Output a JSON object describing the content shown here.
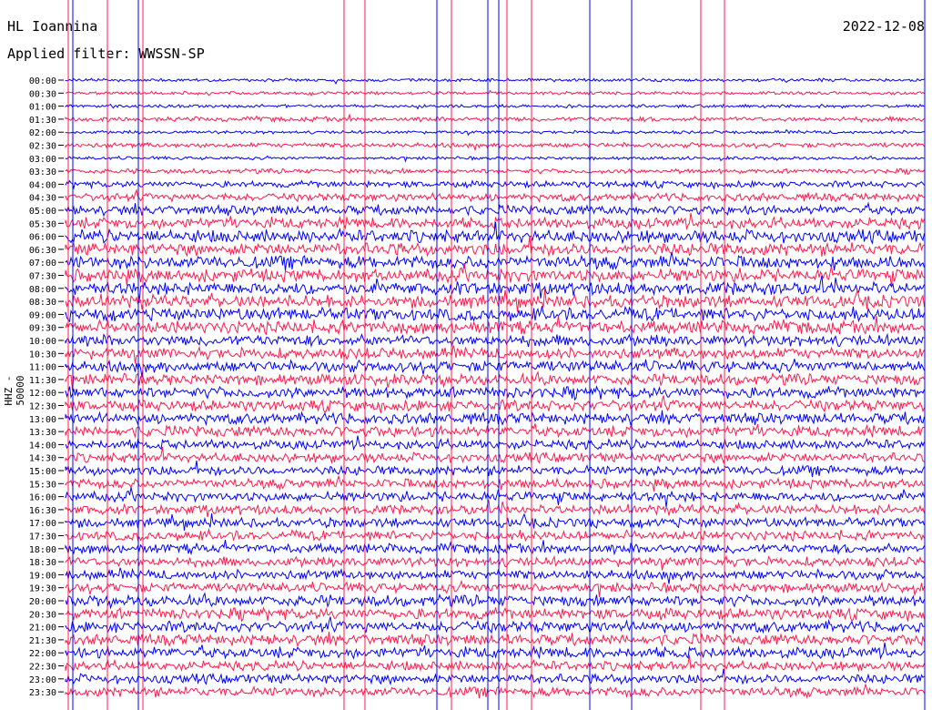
{
  "header": {
    "station": "HL Ioannina",
    "date": "2022-12-08",
    "filter": "Applied filter: WWSSN-SP",
    "channel": "HHZ - 50000"
  },
  "chart_data": {
    "type": "line",
    "title": "HL Ioannina",
    "ylabel": "HHZ - 50000",
    "y_tick_labels": [
      "00:00",
      "00:30",
      "01:00",
      "01:30",
      "02:00",
      "02:30",
      "03:00",
      "03:30",
      "04:00",
      "04:30",
      "05:00",
      "05:30",
      "06:00",
      "06:30",
      "07:00",
      "07:30",
      "08:00",
      "08:30",
      "09:00",
      "09:30",
      "10:00",
      "10:30",
      "11:00",
      "11:30",
      "12:00",
      "12:30",
      "13:00",
      "13:30",
      "14:00",
      "14:30",
      "15:00",
      "15:30",
      "16:00",
      "16:30",
      "17:00",
      "17:30",
      "18:00",
      "18:30",
      "19:00",
      "19:30",
      "20:00",
      "20:30",
      "21:00",
      "21:30",
      "22:00",
      "22:30",
      "23:00",
      "23:30"
    ],
    "series_colors": [
      "#0000ff",
      "#ff1a4d"
    ],
    "trace_amplitude_by_row": [
      2,
      2,
      2,
      3,
      2,
      3,
      2,
      3,
      4,
      5,
      6,
      7,
      8,
      8,
      8,
      8,
      8,
      8,
      8,
      8,
      7,
      7,
      7,
      7,
      7,
      7,
      7,
      7,
      6,
      6,
      6,
      6,
      6,
      6,
      6,
      6,
      6,
      6,
      6,
      6,
      7,
      7,
      7,
      7,
      7,
      6,
      6,
      6
    ],
    "grid": false
  }
}
